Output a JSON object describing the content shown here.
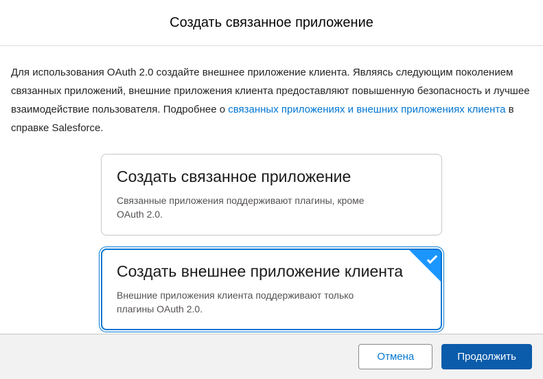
{
  "dialog": {
    "title": "Создать связанное приложение"
  },
  "intro": {
    "text_before": "Для использования OAuth 2.0 создайте внешнее приложение клиента. Являясь следующим поколением связанных приложений, внешние приложения клиента предоставляют повышенную безопасность и лучшее взаимодействие пользователя. Подробнее о ",
    "link_text": "связанных приложениях и внешних приложениях клиента",
    "text_after": " в справке Salesforce."
  },
  "options": [
    {
      "title": "Создать связанное приложение",
      "description": "Связанные приложения поддерживают плагины, кроме OAuth 2.0.",
      "selected": false
    },
    {
      "title": "Создать внешнее приложение клиента",
      "description": "Внешние приложения клиента поддерживают только плагины OAuth 2.0.",
      "selected": true
    }
  ],
  "footer": {
    "cancel_label": "Отмена",
    "continue_label": "Продолжить"
  },
  "colors": {
    "link_blue": "#0176d3",
    "selected_border_blue": "#0176d3",
    "check_triangle_blue": "#1b96ff",
    "continue_button_blue": "#0b5cab",
    "footer_background": "#f3f2f2"
  },
  "icons": {
    "selected_check": "check-icon"
  }
}
